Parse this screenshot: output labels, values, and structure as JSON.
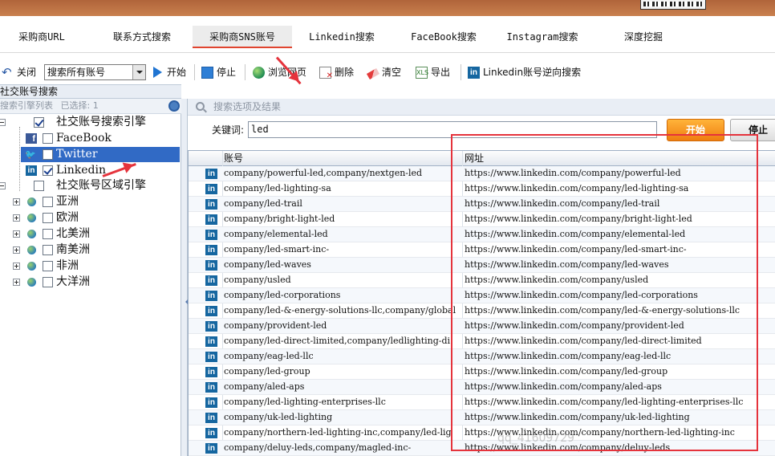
{
  "nav": {
    "tabs": [
      "采购商URL",
      "联系方式搜索",
      "采购商SNS账号",
      "Linkedin搜索",
      "FaceBook搜索",
      "Instagram搜索",
      "深度挖掘"
    ],
    "active_index": 2
  },
  "toolbar": {
    "close": "关闭",
    "select_value": "搜索所有账号",
    "start": "开始",
    "stop": "停止",
    "browse": "浏览网页",
    "delete": "删除",
    "clear": "清空",
    "export": "导出",
    "reverse": "Linkedin账号逆向搜索"
  },
  "left": {
    "panel_title": "社交账号搜索",
    "engine_list_label": "搜索引擎列表",
    "selected_label": "已选择: 1",
    "engine_group": "社交账号搜索引擎",
    "engines": [
      {
        "name": "FaceBook",
        "checked": false,
        "icon": "facebook-icon"
      },
      {
        "name": "Twitter",
        "checked": false,
        "icon": "twitter-icon",
        "selected": true
      },
      {
        "name": "Linkedin",
        "checked": true,
        "icon": "linkedin-icon"
      }
    ],
    "region_group": "社交账号区域引擎",
    "regions": [
      "亚洲",
      "欧洲",
      "北美洲",
      "南美洲",
      "非洲",
      "大洋洲"
    ]
  },
  "right": {
    "section_title": "搜索选项及结果",
    "keyword_label": "关键词:",
    "keyword_value": "led",
    "start_button": "开始",
    "stop_button": "停止",
    "columns": [
      "账号",
      "网址"
    ],
    "rows": [
      {
        "account": "company/powerful-led,company/nextgen-led",
        "url": "https://www.linkedin.com/company/powerful-led"
      },
      {
        "account": "company/led-lighting-sa",
        "url": "https://www.linkedin.com/company/led-lighting-sa"
      },
      {
        "account": "company/led-trail",
        "url": "https://www.linkedin.com/company/led-trail"
      },
      {
        "account": "company/bright-light-led",
        "url": "https://www.linkedin.com/company/bright-light-led"
      },
      {
        "account": "company/elemental-led",
        "url": "https://www.linkedin.com/company/elemental-led"
      },
      {
        "account": "company/led-smart-inc-",
        "url": "https://www.linkedin.com/company/led-smart-inc-"
      },
      {
        "account": "company/led-waves",
        "url": "https://www.linkedin.com/company/led-waves"
      },
      {
        "account": "company/usled",
        "url": "https://www.linkedin.com/company/usled"
      },
      {
        "account": "company/led-corporations",
        "url": "https://www.linkedin.com/company/led-corporations"
      },
      {
        "account": "company/led-&-energy-solutions-llc,company/global",
        "url": "https://www.linkedin.com/company/led-&-energy-solutions-llc"
      },
      {
        "account": "company/provident-led",
        "url": "https://www.linkedin.com/company/provident-led"
      },
      {
        "account": "company/led-direct-limited,company/ledlighting-di",
        "url": "https://www.linkedin.com/company/led-direct-limited"
      },
      {
        "account": "company/eag-led-llc",
        "url": "https://www.linkedin.com/company/eag-led-llc"
      },
      {
        "account": "company/led-group",
        "url": "https://www.linkedin.com/company/led-group"
      },
      {
        "account": "company/aled-aps",
        "url": "https://www.linkedin.com/company/aled-aps"
      },
      {
        "account": "company/led-lighting-enterprises-llc",
        "url": "https://www.linkedin.com/company/led-lighting-enterprises-llc"
      },
      {
        "account": "company/uk-led-lighting",
        "url": "https://www.linkedin.com/company/uk-led-lighting"
      },
      {
        "account": "company/northern-led-lighting-inc,company/led-lig",
        "url": "https://www.linkedin.com/company/northern-led-lighting-inc"
      },
      {
        "account": "company/deluy-leds,company/magled-inc-",
        "url": "https://www.linkedin.com/company/deluy-leds"
      }
    ]
  },
  "watermark": "qq_41609729",
  "colors": {
    "accent": "#e5333c",
    "linkedin": "#1566a0",
    "start": "#ef7d10",
    "selection": "#316ac5"
  }
}
